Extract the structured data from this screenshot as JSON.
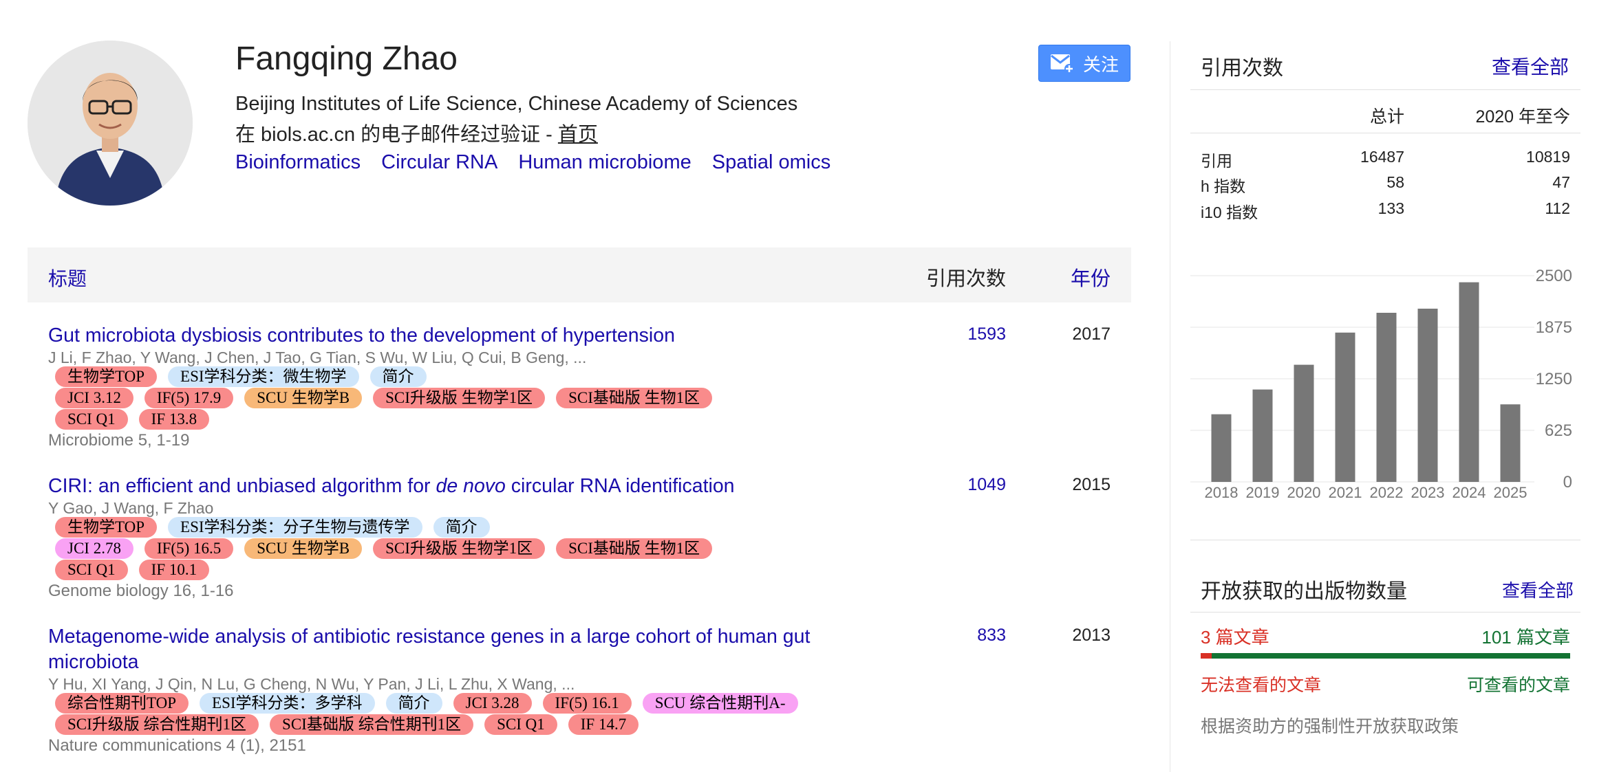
{
  "profile": {
    "name": "Fangqing Zhao",
    "affiliation": "Beijing Institutes of Life Science, Chinese Academy of Sciences",
    "verified_text": "在 biols.ac.cn 的电子邮件经过验证 - ",
    "homepage_label": "首页",
    "interests": [
      "Bioinformatics",
      "Circular RNA",
      "Human microbiome",
      "Spatial omics"
    ],
    "follow_label": "关注"
  },
  "table": {
    "header_title": "标题",
    "header_cited": "引用次数",
    "header_year": "年份"
  },
  "articles": [
    {
      "title": "Gut microbiota dysbiosis contributes to the development of hypertension",
      "authors": "J Li, F Zhao, Y Wang, J Chen, J Tao, G Tian, S Wu, W Liu, Q Cui, B Geng, ...",
      "tag_rows": [
        [
          "生物学TOP",
          "ESI学科分类：微生物学",
          "简介"
        ],
        [
          "JCI 3.12",
          "IF(5) 17.9",
          "SCU 生物学B",
          "SCI升级版 生物学1区",
          "SCI基础版 生物1区"
        ],
        [
          "SCI Q1",
          "IF 13.8"
        ]
      ],
      "venue": "Microbiome 5, 1-19",
      "cited": "1593",
      "year": "2017"
    },
    {
      "title_pre": "CIRI: an efficient and unbiased algorithm for ",
      "title_em": "de novo",
      "title_post": " circular RNA identification",
      "authors": "Y Gao, J Wang, F Zhao",
      "tag_rows": [
        [
          "生物学TOP",
          "ESI学科分类：分子生物与遗传学",
          "简介"
        ],
        [
          "JCI 2.78",
          "IF(5) 16.5",
          "SCU 生物学B",
          "SCI升级版 生物学1区",
          "SCI基础版 生物1区"
        ],
        [
          "SCI Q1",
          "IF 10.1"
        ]
      ],
      "venue": "Genome biology 16, 1-16",
      "cited": "1049",
      "year": "2015"
    },
    {
      "title": "Metagenome-wide analysis of antibiotic resistance genes in a large cohort of human gut microbiota",
      "authors": "Y Hu, XI Yang, J Qin, N Lu, G Cheng, N Wu, Y Pan, J Li, L Zhu, X Wang, ...",
      "tag_rows": [
        [
          "综合性期刊TOP",
          "ESI学科分类：多学科",
          "简介",
          "JCI 3.28",
          "IF(5) 16.1",
          "SCU 综合性期刊A-"
        ],
        [
          "SCI升级版 综合性期刊1区",
          "SCI基础版 综合性期刊1区",
          "SCI Q1",
          "IF 14.7"
        ]
      ],
      "venue": "Nature communications 4 (1), 2151",
      "cited": "833",
      "year": "2013"
    }
  ],
  "tag_colors": {
    "red": "#f98b8b",
    "blue": "#cfe6fb",
    "orange": "#f8b878",
    "pink": "#f9a2f4"
  },
  "citations": {
    "title": "引用次数",
    "view_all": "查看全部",
    "col_total": "总计",
    "col_since": "2020 年至今",
    "rows": [
      {
        "label": "引用",
        "total": "16487",
        "since": "10819"
      },
      {
        "label": "h 指数",
        "total": "58",
        "since": "47"
      },
      {
        "label": "i10 指数",
        "total": "133",
        "since": "112"
      }
    ]
  },
  "chart_data": {
    "type": "bar",
    "categories": [
      "2018",
      "2019",
      "2020",
      "2021",
      "2022",
      "2023",
      "2024",
      "2025"
    ],
    "values": [
      820,
      1120,
      1420,
      1810,
      2050,
      2100,
      2420,
      940
    ],
    "yticks": [
      "0",
      "625",
      "1250",
      "1875",
      "2500"
    ],
    "ylim": [
      0,
      2500
    ],
    "bar_color": "#777777",
    "grid": true
  },
  "open_access": {
    "title": "开放获取的出版物数量",
    "view_all": "查看全部",
    "unavailable_count": "3 篇文章",
    "available_count": "101 篇文章",
    "unavailable_fraction": 0.029,
    "unavailable_label": "无法查看的文章",
    "available_label": "可查看的文章",
    "note": "根据资助方的强制性开放获取政策"
  }
}
